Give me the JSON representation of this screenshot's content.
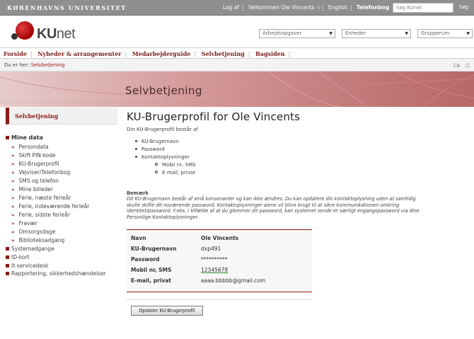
{
  "topbar": {
    "university": "KØBENHAVNS UNIVERSITET",
    "links": [
      "Log af",
      "Velkommen Ole Vincents",
      "English",
      "Telefonbog"
    ],
    "search_placeholder": "Søg KUnet",
    "search_button": "Søg"
  },
  "logo": {
    "ku": "KU",
    "net": "net"
  },
  "dropdowns": [
    "Arbejdsopgaver",
    "Enheder",
    "Grupperum"
  ],
  "nav": [
    "Forside",
    "Nyheder & arrangementer",
    "Medarbejderguide",
    "Selvbetjening",
    "Bagsiden"
  ],
  "breadcrumb": {
    "prefix": "Du er her:",
    "current": "Selvbetjening"
  },
  "banner": {
    "title": "Selvbetjening"
  },
  "sidebar": {
    "header": "Selvbetjening",
    "section": "Mine data",
    "sub_items": [
      "Persondata",
      "Skift PIN-kode",
      "KU-Brugerprofil",
      "Vejviser/Telefonbog",
      "SMS og telefon",
      "Mine billeder",
      "Ferie, næste ferieår",
      "Ferie, indeværende ferieår",
      "Ferie, sidste ferieår",
      "Fravær",
      "Omsorgsdage",
      "Biblioteksadgang"
    ],
    "items": [
      "Systemadgange",
      "ID-kort",
      "It-servicedesk",
      "Rapportering, sikkerhedshændelser"
    ]
  },
  "main": {
    "title": "KU-Brugerprofil for Ole Vincents",
    "intro": "Din KU-Brugerprofil består af",
    "bullets": [
      "KU-Brugernavn",
      "Password",
      "Kontaktoplysninger"
    ],
    "sub_bullets": [
      "Mobil nr, SMS",
      "E-mail, privat"
    ],
    "remark_title": "Bemærk",
    "remark_text": "Dit KU-Brugernavn består af små konsonanter og kan ikke ændres. Du kan opdatere din kontaktoplysning uden at samtidig skulle skifte dit nuværende password. Kontaktoplysninger alene vil blive brugt til at sikre kommunikationen omkring identitet/password. F.eks. i tilfælde af at du glemmer dit password, kan systemet sende et særligt engangspassword via dine Personlige Kontaktoplysninger.",
    "profile": [
      {
        "label": "Navn",
        "value": "Ole Vincents"
      },
      {
        "label": "KU-Brugernavn",
        "value": "dxp491"
      },
      {
        "label": "Password",
        "value": "**********"
      },
      {
        "label": "Mobil nr, SMS",
        "value": "12345678"
      },
      {
        "label": "E-mail, privat",
        "value": "aaaa.bbbbb@gmail.com"
      }
    ],
    "update_button": "Opdater KU-Brugerprofil"
  }
}
